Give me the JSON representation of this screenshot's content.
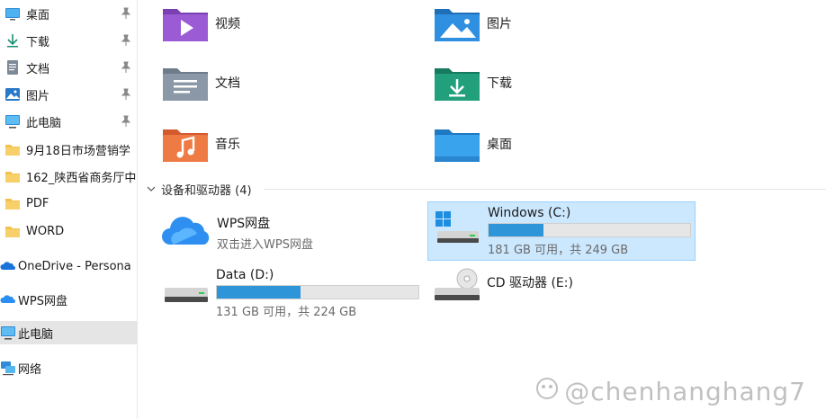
{
  "sidebar": {
    "items": [
      {
        "label": "桌面",
        "icon": "desktop-icon",
        "pinned": true
      },
      {
        "label": "下载",
        "icon": "download-icon",
        "pinned": true
      },
      {
        "label": "文档",
        "icon": "document-icon",
        "pinned": true
      },
      {
        "label": "图片",
        "icon": "picture-icon",
        "pinned": true
      },
      {
        "label": "此电脑",
        "icon": "computer-icon",
        "pinned": true
      },
      {
        "label": "9月18日市场营销学",
        "icon": "folder-icon"
      },
      {
        "label": "162_陕西省商务厅中",
        "icon": "folder-icon"
      },
      {
        "label": "PDF",
        "icon": "folder-icon"
      },
      {
        "label": "WORD",
        "icon": "folder-icon"
      },
      {
        "label": "OneDrive - Persona",
        "icon": "onedrive-icon"
      },
      {
        "label": "WPS网盘",
        "icon": "wps-cloud-icon"
      },
      {
        "label": "此电脑",
        "icon": "computer-icon",
        "selected": true
      },
      {
        "label": "网络",
        "icon": "network-icon"
      }
    ]
  },
  "folders": [
    {
      "label": "视频",
      "icon": "videos-folder-icon"
    },
    {
      "label": "图片",
      "icon": "pictures-folder-icon"
    },
    {
      "label": "文档",
      "icon": "documents-folder-icon"
    },
    {
      "label": "下载",
      "icon": "downloads-folder-icon"
    },
    {
      "label": "音乐",
      "icon": "music-folder-icon"
    },
    {
      "label": "桌面",
      "icon": "desktop-folder-icon"
    }
  ],
  "devices": {
    "header": "设备和驱动器 (4)",
    "wps": {
      "title": "WPS网盘",
      "subtitle": "双击进入WPS网盘"
    },
    "c": {
      "title": "Windows (C:)",
      "space": "181 GB 可用，共 249 GB",
      "used_fraction": 0.273
    },
    "d": {
      "title": "Data (D:)",
      "space": "131 GB 可用，共 224 GB",
      "used_fraction": 0.415
    },
    "e": {
      "title": "CD 驱动器 (E:)"
    }
  },
  "watermark": "@chenhanghang7",
  "colors": {
    "accent": "#2e95d8",
    "selection": "#cce8ff",
    "selection_border": "#99d1ff"
  }
}
